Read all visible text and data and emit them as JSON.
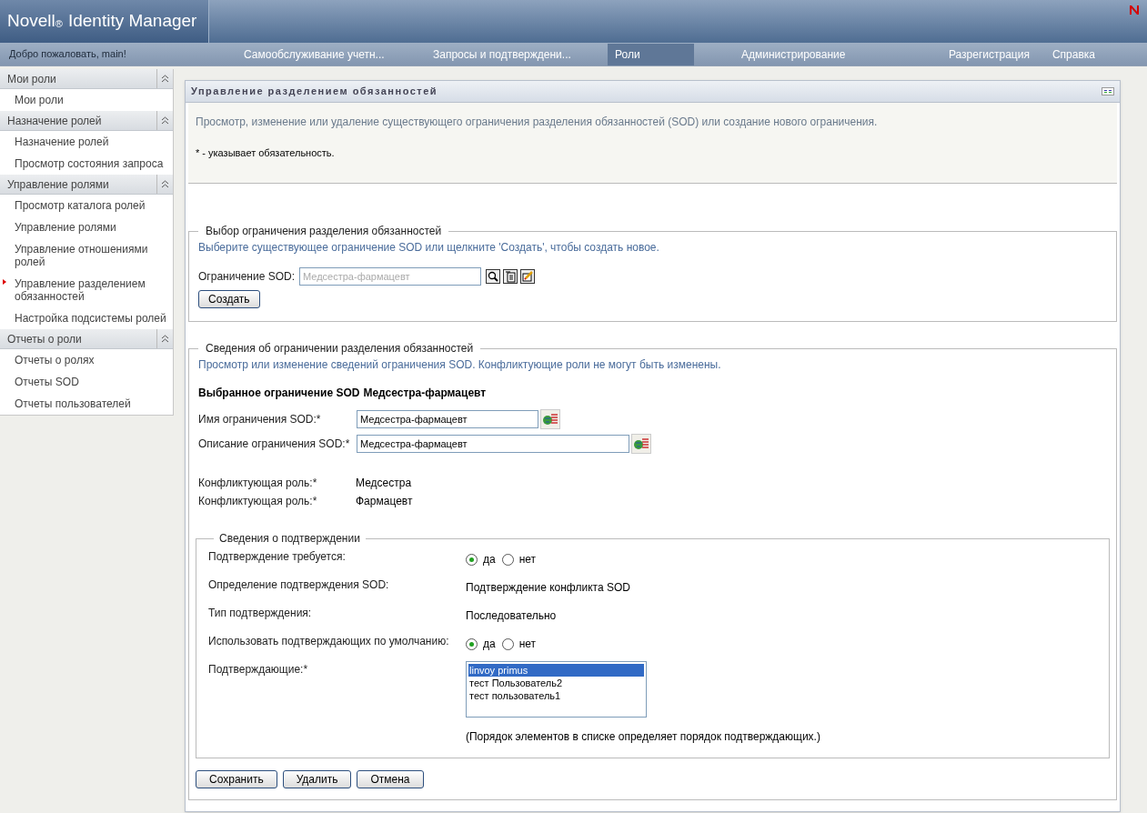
{
  "header": {
    "product": "Novell",
    "registered": "®",
    "title": "Identity Manager"
  },
  "nav": {
    "welcome": "Добро пожаловать, main!",
    "tabs": [
      {
        "label": "Самообслуживание учетн...",
        "selected": false
      },
      {
        "label": "Запросы и подтверждени...",
        "selected": false
      },
      {
        "label": "Роли",
        "selected": true
      },
      {
        "label": "Администрирование",
        "selected": false
      }
    ],
    "links": [
      "Разрегистрация",
      "Справка"
    ]
  },
  "sidebar": [
    {
      "title": "Мои роли",
      "expanded": true,
      "items": [
        {
          "label": "Мои роли",
          "selected": false
        }
      ]
    },
    {
      "title": "Назначение ролей",
      "expanded": true,
      "items": [
        {
          "label": "Назначение ролей",
          "selected": false
        },
        {
          "label": "Просмотр состояния запроса",
          "selected": false
        }
      ]
    },
    {
      "title": "Управление ролями",
      "expanded": true,
      "items": [
        {
          "label": "Просмотр каталога ролей",
          "selected": false
        },
        {
          "label": "Управление ролями",
          "selected": false
        },
        {
          "label": "Управление отношениями ролей",
          "selected": false
        },
        {
          "label": "Управление разделением обязанностей",
          "selected": true
        },
        {
          "label": "Настройка подсистемы ролей",
          "selected": false
        }
      ]
    },
    {
      "title": "Отчеты о роли",
      "expanded": true,
      "items": [
        {
          "label": "Отчеты о ролях",
          "selected": false
        },
        {
          "label": "Отчеты SOD",
          "selected": false
        },
        {
          "label": "Отчеты пользователей",
          "selected": false
        }
      ]
    }
  ],
  "panel": {
    "title": "Управление разделением обязанностей",
    "intro": "Просмотр, изменение или удаление существующего ограничения разделения обязанностей (SOD) или создание нового ограничения.",
    "required_note": "* - указывает обязательность.",
    "selection": {
      "legend": "Выбор ограничения разделения обязанностей",
      "hint": "Выберите существующее ограничение SOD или щелкните 'Создать', чтобы создать новое.",
      "label": "Ограничение SOD:",
      "placeholder": "Медсестра-фармацевт",
      "create_button": "Создать"
    },
    "details": {
      "legend": "Сведения об ограничении разделения обязанностей",
      "hint": "Просмотр или изменение сведений ограничения SOD. Конфликтующие роли не могут быть изменены.",
      "selected_heading": "Выбранное ограничение SOD",
      "selected_value": "Медсестра-фармацевт",
      "fields": [
        {
          "label": "Имя ограничения SOD:*",
          "value": "Медсестра-фармацевт",
          "wide": false
        },
        {
          "label": "Описание ограничения SOD:*",
          "value": "Медсестра-фармацевт",
          "wide": true
        }
      ],
      "conflicts": [
        {
          "label": "Конфликтующая роль:*",
          "value": "Медсестра"
        },
        {
          "label": "Конфликтующая роль:*",
          "value": "Фармацевт"
        }
      ],
      "approval": {
        "legend": "Сведения о подтверждении",
        "rows": [
          {
            "kind": "radio",
            "label": "Подтверждение требуется:",
            "options": [
              {
                "label": "да",
                "selected": true
              },
              {
                "label": "нет",
                "selected": false
              }
            ]
          },
          {
            "kind": "text",
            "label": "Определение подтверждения SOD:",
            "value": "Подтверждение конфликта SOD"
          },
          {
            "kind": "text",
            "label": "Тип подтверждения:",
            "value": "Последовательно"
          },
          {
            "kind": "radio",
            "label": "Использовать подтверждающих по умолчанию:",
            "options": [
              {
                "label": "да",
                "selected": true
              },
              {
                "label": "нет",
                "selected": false
              }
            ]
          },
          {
            "kind": "list",
            "label": "Подтверждающие:*",
            "items": [
              {
                "label": "linvoy primus",
                "selected": true
              },
              {
                "label": "тест Пользователь2",
                "selected": false
              },
              {
                "label": "тест пользователь1",
                "selected": false
              }
            ],
            "note": "(Порядок элементов в списке определяет порядок подтверждающих.)"
          }
        ]
      },
      "buttons": [
        "Сохранить",
        "Удалить",
        "Отмена"
      ]
    }
  }
}
